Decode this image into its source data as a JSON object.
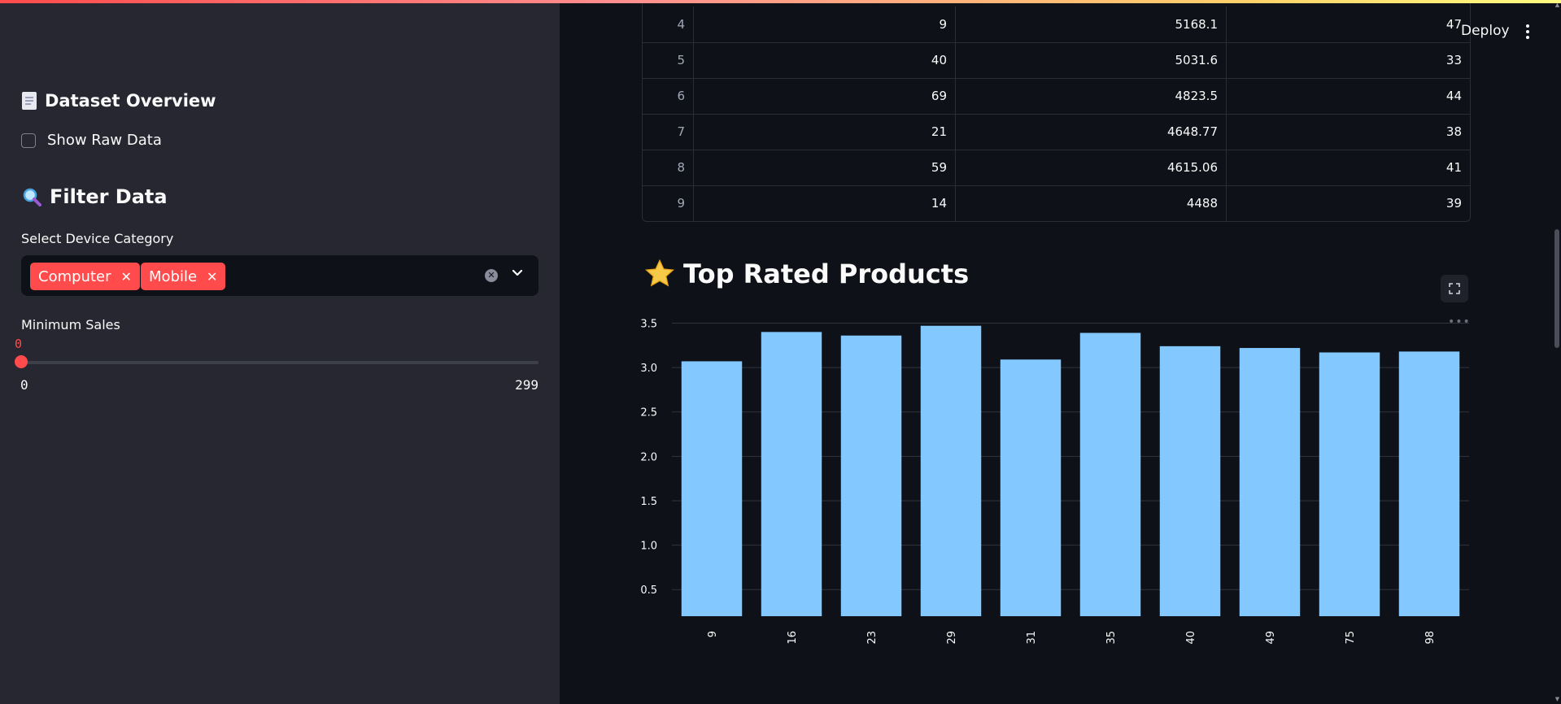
{
  "sidebar": {
    "dataset_overview_title": "Dataset Overview",
    "show_raw_data_label": "Show Raw Data",
    "show_raw_data_checked": false,
    "filter_title": "Filter Data",
    "device_category_label": "Select Device Category",
    "device_categories": [
      "Computer",
      "Mobile"
    ],
    "min_sales_label": "Minimum Sales",
    "min_sales_value": "0",
    "min_sales_min": "0",
    "min_sales_max": "299"
  },
  "header": {
    "deploy_label": "Deploy"
  },
  "table": {
    "rows": [
      [
        "4",
        "9",
        "5168.1",
        "47"
      ],
      [
        "5",
        "40",
        "5031.6",
        "33"
      ],
      [
        "6",
        "69",
        "4823.5",
        "44"
      ],
      [
        "7",
        "21",
        "4648.77",
        "38"
      ],
      [
        "8",
        "59",
        "4615.06",
        "41"
      ],
      [
        "9",
        "14",
        "4488",
        "39"
      ]
    ]
  },
  "chart_section": {
    "title": "Top Rated Products"
  },
  "colors": {
    "accent": "#ff4b4b",
    "bar": "#83c9ff",
    "sidebar_bg": "#262730",
    "main_bg": "#0e1117"
  },
  "chart_data": {
    "type": "bar",
    "title": "",
    "xlabel": "",
    "ylabel": "",
    "categories": [
      "9",
      "16",
      "23",
      "29",
      "31",
      "35",
      "40",
      "49",
      "75",
      "98"
    ],
    "values": [
      3.07,
      3.4,
      3.36,
      3.47,
      3.09,
      3.39,
      3.24,
      3.22,
      3.17,
      3.18
    ],
    "ylim": [
      0.2,
      3.55
    ],
    "yticks": [
      "0.5",
      "1.0",
      "1.5",
      "2.0",
      "2.5",
      "3.0",
      "3.5"
    ],
    "grid": true
  }
}
